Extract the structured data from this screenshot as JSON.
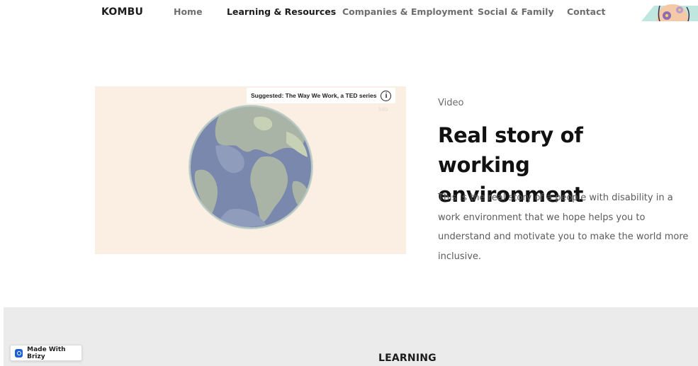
{
  "nav": {
    "brand": "KOMBU",
    "items": [
      {
        "label": "Home"
      },
      {
        "label": "Learning & Resources"
      },
      {
        "label": "Companies & Employment"
      },
      {
        "label": "Social & Family"
      },
      {
        "label": "Contact"
      }
    ],
    "active_item": "Learning & Resources"
  },
  "video": {
    "suggestion": "Suggested: The Way We Work, a TED series",
    "info_glyph": "i",
    "info_label": "Info",
    "background_color": "#fbefe4"
  },
  "content": {
    "eyebrow": "Video",
    "title": "Real story of working environment",
    "description": "This is the real story of a people with disability in a work environment that we hope helps you to understand and motivate you to make the world more inclusive."
  },
  "section": {
    "title": "LEARNING"
  },
  "badge": {
    "label": "Made With Brizy",
    "icon": "brizy-logo-icon",
    "accent": "#1d5fd6"
  },
  "colors": {
    "band": "#ebebeb",
    "text_dark": "#111111",
    "text_muted": "#5b5b5b"
  }
}
